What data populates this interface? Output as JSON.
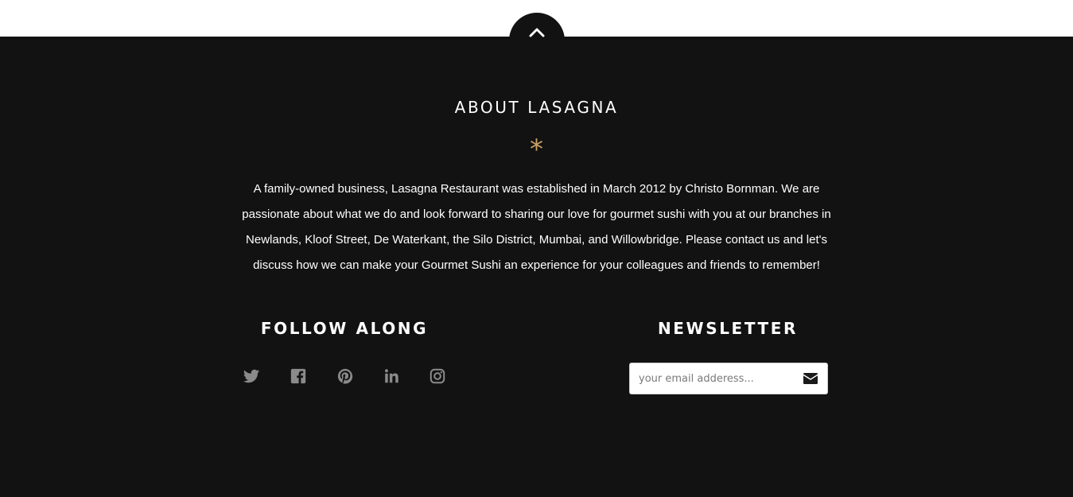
{
  "colors": {
    "footer_background": "#121212",
    "top_background": "#ffffff",
    "accent": "#c9a063",
    "heading_text": "#ffffff",
    "icon_gray": "#8a8a8a"
  },
  "back_to_top": {
    "icon": "chevron-up-icon"
  },
  "about": {
    "title": "ABOUT LASAGNA",
    "divider": "*",
    "text": "A family-owned business, Lasagna Restaurant was established in March 2012 by Christo Bornman. We are passionate about what we do and look forward to sharing our love for gourmet sushi with you at our branches in Newlands, Kloof Street, De Waterkant, the Silo District, Mumbai, and Willowbridge. Please contact us and let's discuss how we can make your Gourmet Sushi an experience for your colleagues and friends to remember!"
  },
  "follow": {
    "title": "FOLLOW ALONG",
    "icons": [
      "twitter-icon",
      "facebook-icon",
      "pinterest-icon",
      "linkedin-icon",
      "instagram-icon"
    ]
  },
  "newsletter": {
    "title": "NEWSLETTER",
    "placeholder": "your email adderess...",
    "value": "",
    "submit_icon": "envelope-icon"
  }
}
